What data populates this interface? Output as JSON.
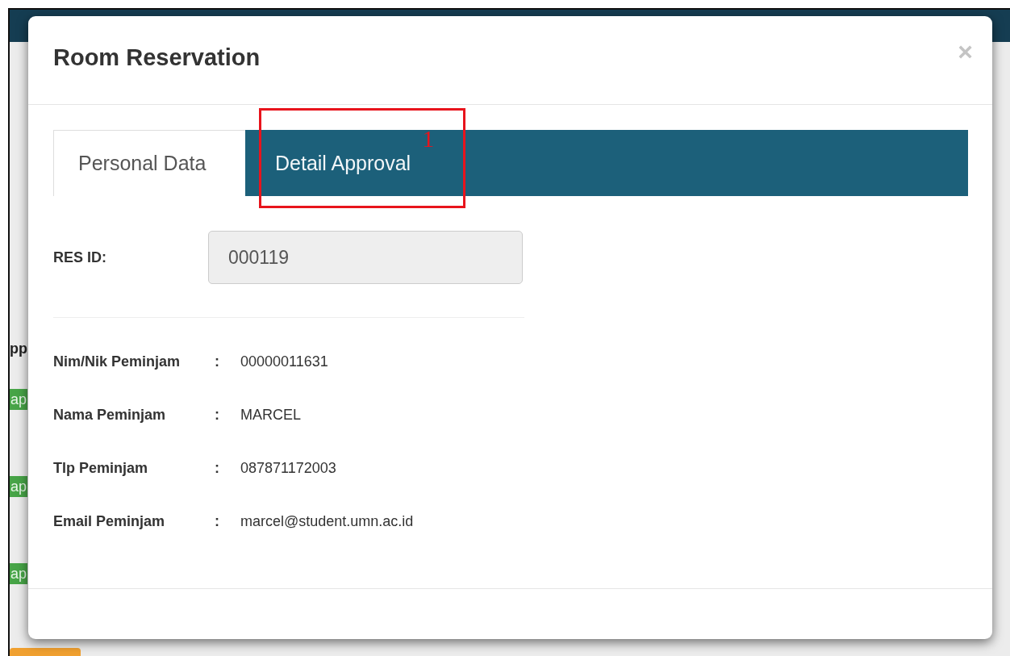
{
  "background": {
    "header_fragment": "pp",
    "badges": [
      {
        "label": "ap"
      },
      {
        "label": "ap"
      },
      {
        "label": "ap"
      }
    ]
  },
  "modal": {
    "title": "Room Reservation",
    "close": "×",
    "tabs": [
      {
        "label": "Personal Data",
        "selected": true
      },
      {
        "label": "Detail Approval",
        "selected": false,
        "callout": "1"
      }
    ],
    "res_id": {
      "label": "RES ID:",
      "value": "000119"
    },
    "details": [
      {
        "label": "Nim/Nik Peminjam",
        "separator": ":",
        "value": "00000011631"
      },
      {
        "label": "Nama Peminjam",
        "separator": ":",
        "value": "MARCEL"
      },
      {
        "label": "Tlp Peminjam",
        "separator": ":",
        "value": "087871172003"
      },
      {
        "label": "Email Peminjam",
        "separator": ":",
        "value": "marcel@student.umn.ac.id"
      }
    ]
  }
}
